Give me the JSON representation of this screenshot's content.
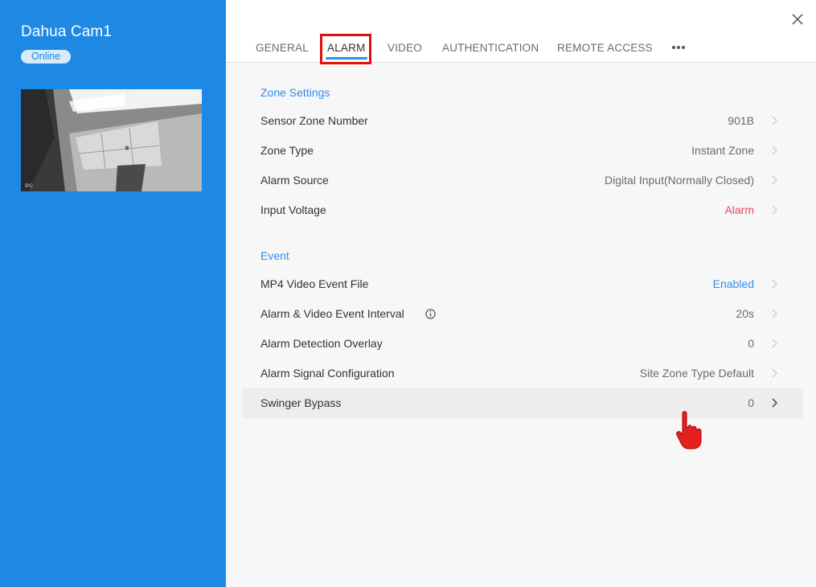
{
  "device": {
    "name": "Dahua Cam1",
    "status": "Online",
    "thumbnail_timestamp": "2022-07-21 18:08:29",
    "thumbnail_watermark": "IPC"
  },
  "tabs": [
    {
      "label": "GENERAL",
      "active": false
    },
    {
      "label": "ALARM",
      "active": true
    },
    {
      "label": "VIDEO",
      "active": false
    },
    {
      "label": "AUTHENTICATION",
      "active": false
    },
    {
      "label": "REMOTE ACCESS",
      "active": false
    }
  ],
  "more_icon": "more-horizontal-icon",
  "close_icon": "close-icon",
  "zone_settings": {
    "title": "Zone Settings",
    "rows": [
      {
        "label": "Sensor Zone Number",
        "value": "901B"
      },
      {
        "label": "Zone Type",
        "value": "Instant Zone"
      },
      {
        "label": "Alarm Source",
        "value": "Digital Input(Normally Closed)"
      },
      {
        "label": "Input Voltage",
        "value": "Alarm"
      }
    ]
  },
  "event": {
    "title": "Event",
    "rows": [
      {
        "label": "MP4 Video Event File",
        "value": "Enabled"
      },
      {
        "label": "Alarm & Video Event Interval",
        "value": "20s"
      },
      {
        "label": "Alarm Detection Overlay",
        "value": "0"
      },
      {
        "label": "Alarm Signal Configuration",
        "value": "Site Zone Type Default"
      },
      {
        "label": "Swinger Bypass",
        "value": "0"
      }
    ]
  },
  "colors": {
    "sidebar": "#1e88e5",
    "accent": "#2f8ff0",
    "alarm": "#e84a5f",
    "highlight_box": "#e01010"
  }
}
